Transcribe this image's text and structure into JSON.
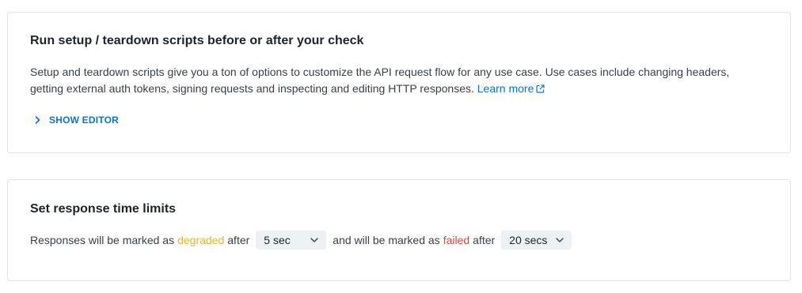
{
  "setup_card": {
    "title": "Run setup / teardown scripts before or after your check",
    "description": "Setup and teardown scripts give you a ton of options to customize the API request flow for any use case. Use cases include changing headers, getting external auth tokens, signing requests and inspecting and editing HTTP responses.",
    "learn_more_label": "Learn more",
    "show_editor_label": "SHOW EDITOR"
  },
  "limits_card": {
    "title": "Set response time limits",
    "prefix": "Responses will be marked as",
    "degraded_word": "degraded",
    "after_1": "after",
    "degraded_value": "5 sec",
    "middle": "and will be marked as",
    "failed_word": "failed",
    "after_2": "after",
    "failed_value": "20 secs"
  },
  "colors": {
    "accent": "#0a73d9",
    "degraded": "#f0b429",
    "failed": "#e5423a",
    "select_bg": "#eef1f4",
    "border": "#e1e4e8"
  },
  "icons": {
    "external_link": "external-link-icon",
    "chevron_right": "chevron-right-icon",
    "chevron_down": "chevron-down-icon"
  }
}
